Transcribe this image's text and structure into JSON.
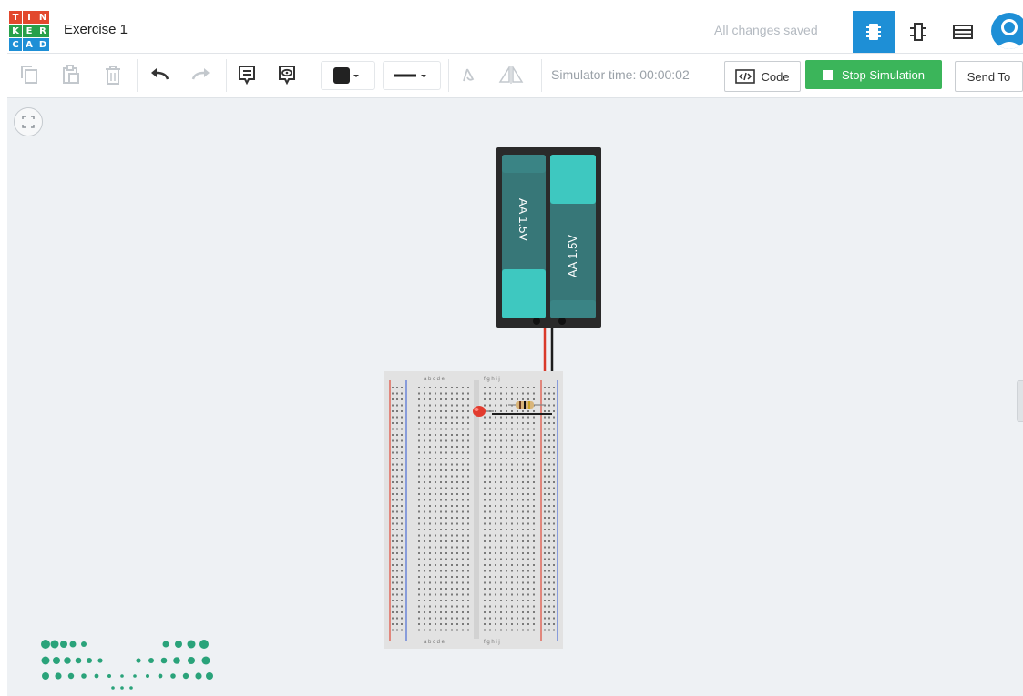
{
  "app": {
    "logo_letters": [
      "T",
      "I",
      "N",
      "K",
      "E",
      "R",
      "C",
      "A",
      "D"
    ],
    "project_title": "Exercise 1",
    "save_status": "All changes saved"
  },
  "colors": {
    "brand_blue": "#1e8fd6",
    "sim_green": "#3bb55a",
    "logo_tiles": [
      "#e2482d",
      "#e2482d",
      "#e2482d",
      "#27a04a",
      "#27a04a",
      "#27a04a",
      "#1e8fd6",
      "#1e8fd6",
      "#1e8fd6"
    ]
  },
  "view_buttons": [
    {
      "name": "circuit-view",
      "icon": "chip-icon",
      "active": true
    },
    {
      "name": "schematic-view",
      "icon": "schematic-icon",
      "active": false
    },
    {
      "name": "component-list-view",
      "icon": "list-icon",
      "active": false
    }
  ],
  "toolbar": {
    "simulator_time": "Simulator time: 00:00:02",
    "code_label": "Code",
    "stop_label": "Stop Simulation",
    "send_label": "Send To"
  },
  "circuit": {
    "battery_labels": [
      "AA 1.5V",
      "AA 1.5V"
    ],
    "breadboard_header_left": "a b c d e",
    "breadboard_header_right": "f g h i j"
  }
}
